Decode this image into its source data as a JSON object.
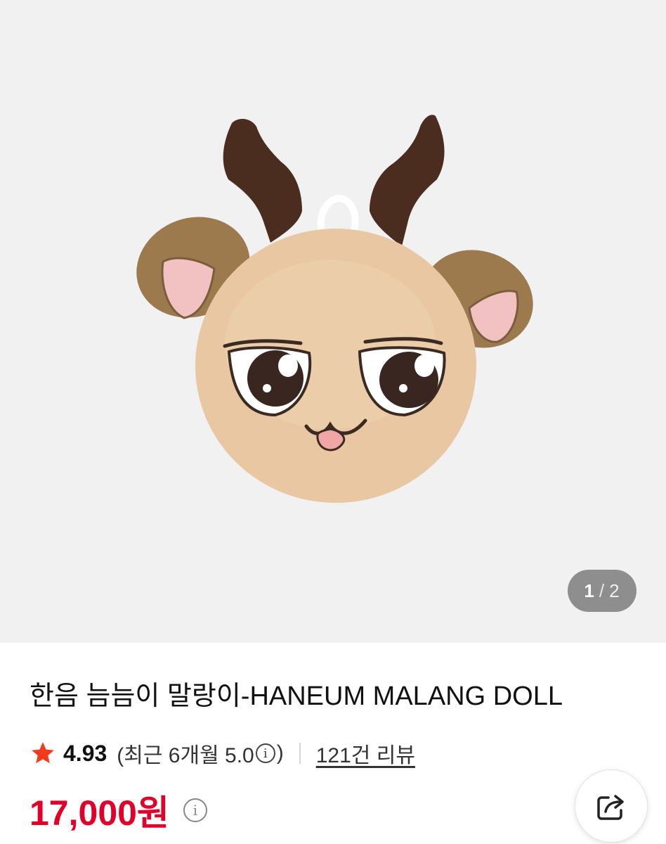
{
  "gallery": {
    "image_alt": "HANEUM MALANG DOLL product photo",
    "counter": {
      "current": "1",
      "separator": "/",
      "total": "2"
    }
  },
  "product": {
    "title": "한음 늠늠이 말랑이-HANEUM MALANG DOLL",
    "rating": "4.93",
    "recent_prefix": "(최근 6개월 5.0",
    "recent_suffix": ")",
    "info_glyph": "i",
    "reviews": "121건 리뷰",
    "price": "17,000원"
  },
  "icons": {
    "star": "star-icon",
    "info": "info-icon",
    "share": "share-icon"
  },
  "colors": {
    "accent_price": "#e0002a",
    "star": "#f23a1e",
    "gallery_bg": "#f1f1f1"
  }
}
